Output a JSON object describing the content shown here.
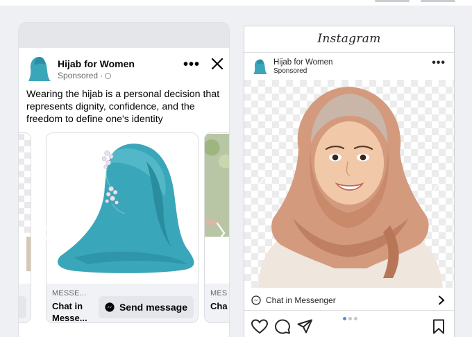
{
  "facebook": {
    "page_name": "Hijab for Women",
    "sponsored": "Sponsored ·",
    "more": "•••",
    "primary_text": "Wearing the hijab is a personal decision that represents dignity, confidence, and the freedom to define one's identity",
    "cards": [
      {
        "domain": "MESSE...",
        "title": "Chat in Messe...",
        "cta": "Send message"
      },
      {
        "domain": "MES",
        "title": "Cha Me"
      }
    ]
  },
  "instagram": {
    "logo": "Instagram",
    "page_name": "Hijab for Women",
    "sponsored": "Sponsored",
    "more": "•••",
    "cta": "Chat in Messenger",
    "carousel": {
      "current": 1,
      "total": 3
    }
  },
  "colors": {
    "fb_card_meta_bg": "#f0f2f5",
    "fb_button_bg": "#e4e6eb",
    "hijab_teal": "#3aa6b9",
    "hijab_peach": "#d49a7e"
  }
}
